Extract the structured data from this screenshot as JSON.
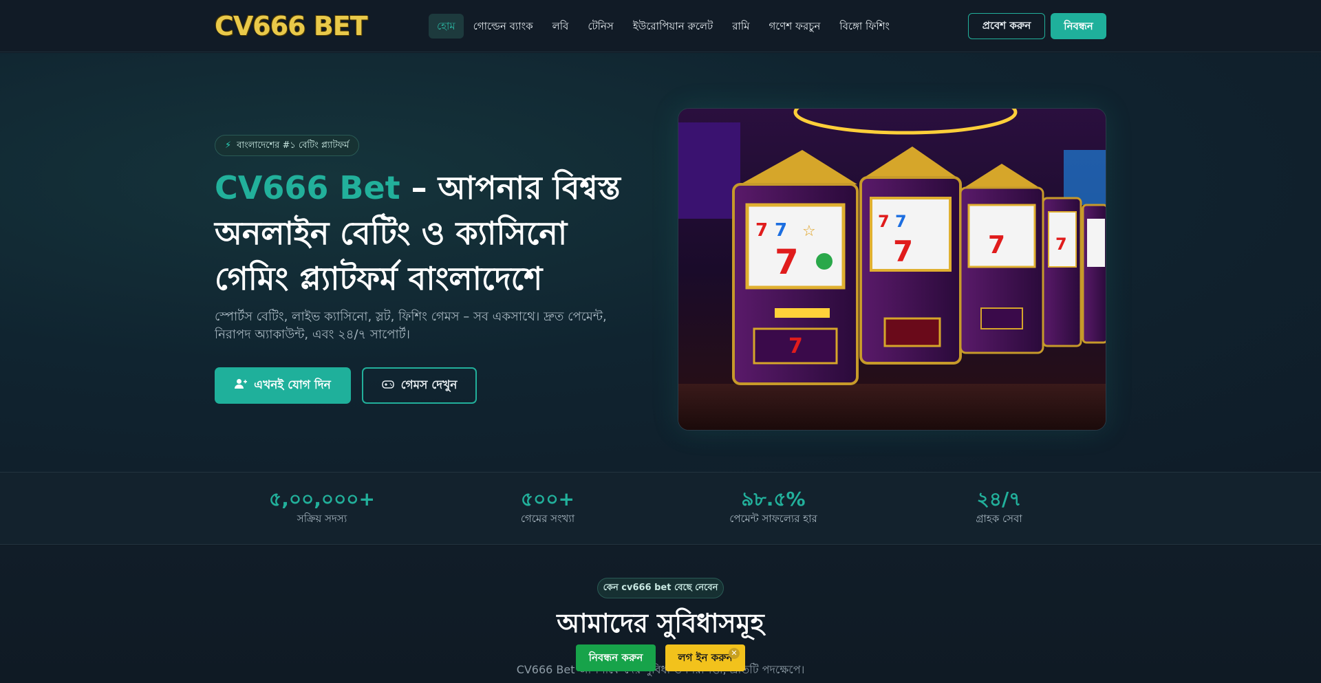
{
  "header": {
    "logo": "CV666 BET",
    "nav": [
      "হোম",
      "গোল্ডেন ব্যাংক",
      "লবি",
      "টেনিস",
      "ইউরোপিয়ান রুলেট",
      "রামি",
      "গণেশ ফরচুন",
      "বিঙ্গো ফিশিং"
    ],
    "login_label": "প্রবেশ করুন",
    "register_label": "নিবন্ধন"
  },
  "hero": {
    "badge": "বাংলাদেশের #১ বেটিং প্ল্যাটফর্ম",
    "title_accent": "CV666 Bet",
    "title_rest": " – আপনার বিশ্বস্ত অনলাইন বেটিং ও ক্যাসিনো গেমিং প্ল্যাটফর্ম বাংলাদেশে",
    "subtitle": "স্পোর্টস বেটিং, লাইভ ক্যাসিনো, স্লট, ফিশিং গেমস – সব একসাথে। দ্রুত পেমেন্ট, নিরাপদ অ্যাকাউন্ট, এবং ২৪/৭ সাপোর্ট।",
    "join_label": "এখনই যোগ দিন",
    "games_label": "গেমস দেখুন"
  },
  "stats": [
    {
      "value": "৫,০০,০০০+",
      "label": "সক্রিয় সদস্য"
    },
    {
      "value": "৫০০+",
      "label": "গেমের সংখ্যা"
    },
    {
      "value": "৯৮.৫%",
      "label": "পেমেন্ট সাফল্যের হার"
    },
    {
      "value": "২৪/৭",
      "label": "গ্রাহক সেবা"
    }
  ],
  "features": {
    "badge": "কেন cv666 bet বেছে নেবেন",
    "title": "আমাদের সুবিধাসমূহ",
    "subtitle": "CV666 Bet আপনাকে দেয় সুবিধা ও নিরাপত্তা, প্রতিটি পদক্ষেপে।"
  },
  "floating": {
    "register_label": "নিবন্ধন করুন",
    "login_label": "লগ ইন করুন",
    "close_icon": "✕"
  },
  "colors": {
    "accent": "#22b09b",
    "register_green": "#17a34a",
    "login_yellow": "#f2c21c",
    "logo_gold": "#e9c94a"
  }
}
